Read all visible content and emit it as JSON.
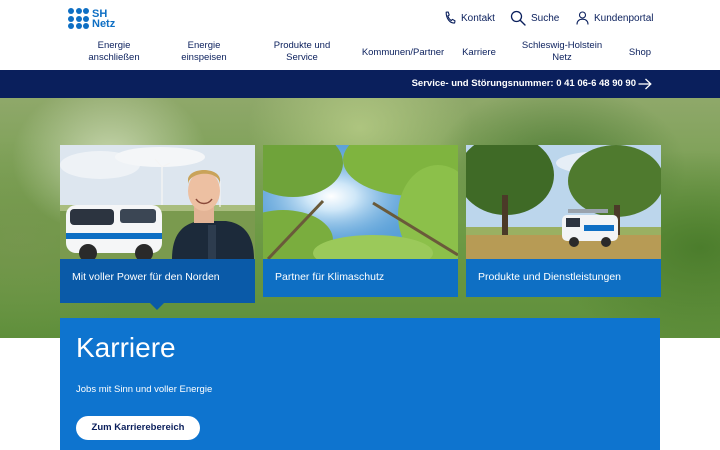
{
  "logo": {
    "line1": "SH",
    "line2": "Netz"
  },
  "utility": {
    "kontakt": "Kontakt",
    "suche": "Suche",
    "kundenportal": "Kundenportal"
  },
  "nav": {
    "items": [
      {
        "line1": "Energie",
        "line2": "anschließen"
      },
      {
        "line1": "Energie",
        "line2": "einspeisen"
      },
      {
        "line1": "Produkte und",
        "line2": "Service"
      },
      {
        "line1": "Kommunen/Partner",
        "line2": ""
      },
      {
        "line1": "Karriere",
        "line2": ""
      },
      {
        "line1": "Schleswig-Holstein",
        "line2": "Netz"
      },
      {
        "line1": "Shop",
        "line2": ""
      }
    ]
  },
  "service_bar": {
    "text": "Service- und Störungsnummer: 0 41 06-6 48 90 90"
  },
  "cards": [
    {
      "label": "Mit voller Power für den Norden"
    },
    {
      "label": "Partner für Klimaschutz"
    },
    {
      "label": "Produkte und Dienstleistungen"
    }
  ],
  "karriere": {
    "title": "Karriere",
    "subtitle": "Jobs mit Sinn und voller Energie",
    "button": "Zum Karrierebereich"
  },
  "colors": {
    "navy": "#0a1f5c",
    "brand_blue": "#0e6fc4",
    "karriere_blue": "#0e74cf"
  },
  "icons": [
    "phone-icon",
    "search-icon",
    "user-icon",
    "arrow-right-icon"
  ]
}
